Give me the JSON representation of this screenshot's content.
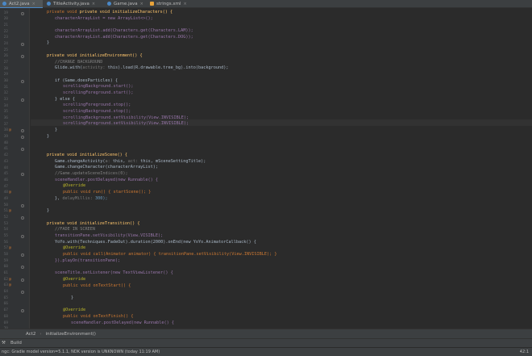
{
  "tabs": [
    {
      "label": "Act2.java",
      "icon_color": "#4a88c7",
      "active": true
    },
    {
      "label": "TitleActivity.java",
      "icon_color": "#4a88c7",
      "active": false
    },
    {
      "label": "Game.java",
      "icon_color": "#4a88c7",
      "active": false
    },
    {
      "label": "strings.xml",
      "icon_color": "#e8a33a",
      "active": false
    }
  ],
  "line_numbers": [
    "19",
    "20",
    "21",
    "22",
    "23",
    "24",
    "25",
    "26",
    "27",
    "28",
    "29",
    "30",
    "31",
    "32",
    "33",
    "34",
    "35",
    "36",
    "37",
    "38",
    "39",
    "40",
    "41",
    "42",
    "43",
    "44",
    "45",
    "46",
    "47",
    "48",
    "49",
    "50",
    "51",
    "52",
    "53",
    "54",
    "55",
    "56",
    "57",
    "58",
    "59",
    "60",
    "61",
    "62",
    "63",
    "64",
    "65",
    "66",
    "67",
    "68",
    "69",
    "70"
  ],
  "gutter_markers": {
    "38": "@",
    "48": "@",
    "51": "@",
    "57": "@",
    "62": "@",
    "63": "@"
  },
  "code": {
    "l19": "private void initializeCharacters() {",
    "l20": "characterArrayList = new ArrayList<>();",
    "l22": "characterArrayList.add(Characters.get(Characters.LAM));",
    "l23": "characterArrayList.add(Characters.get(Characters.DOG));",
    "l24": "}",
    "l26": "private void initializeEnvironment() {",
    "l27": "//CHANGE BACKGROUND",
    "l28a": "Glide.with(",
    "l28b": "activity:",
    "l28c": " this).load(R.drawable.tree_bg).into(background);",
    "l30": "if (Game.doesParticles) {",
    "l31": "scrollingBackground.start();",
    "l32": "scrollingForeground.start();",
    "l33": "} else {",
    "l34": "scrollingForeground.stop();",
    "l35": "scrollingBackground.stop();",
    "l36": "scrollingBackground.setVisibility(View.INVISIBLE);",
    "l37": "scrollingForeground.setVisibility(View.INVISIBLE);",
    "l38": "}",
    "l39": "}",
    "l41": "private void initializeScene() {",
    "l42a": "Game.changeActivity(",
    "l42b": "a:",
    "l42c": " this, ",
    "l42d": "act:",
    "l42e": " this, mSceneSettingTitle);",
    "l43": "Game.changeCharacter(characterArrayList);",
    "l44": "//Game.updateSceneIndices(0);",
    "l45": "sceneHandler.postDelayed(new Runnable() {",
    "l46": "@Override",
    "l47": "public void run() { startScene(); }",
    "l48a": "}, ",
    "l48b": "delayMillis:",
    "l48c": " 300);",
    "l50": "}",
    "l52": "private void initializeTransition() {",
    "l53": "//FADE IN SCREEN",
    "l54": "transitionPane.setVisibility(View.VISIBLE);",
    "l55": "YoYo.with(Techniques.FadeOut).duration(2000).onEnd(new YoYo.AnimatorCallback() {",
    "l56": "@Override",
    "l57": "public void call(Animator animator) { transitionPane.setVisibility(View.INVISIBLE); }",
    "l58": "}).playOn(transitionPane);",
    "l60": "sceneTitle.setListener(new TextViewListener() {",
    "l61": "@Override",
    "l62": "public void onTextStart() {",
    "l64": "}",
    "l66": "@Override",
    "l67": "public void onTextFinish() {",
    "l68": "sceneHandler.postDelayed(new Runnable() {",
    "l69": "@Override"
  },
  "breadcrumb": {
    "class_name": "Act2",
    "sep": "›",
    "method": "initializeEnvironment()"
  },
  "toolwindows": {
    "build_label": "Build"
  },
  "status": {
    "message": "ngc: Gradle model version=5.1.1, NDK version is UNKNOWN (today 11:19 AM)",
    "position": "42:1"
  }
}
